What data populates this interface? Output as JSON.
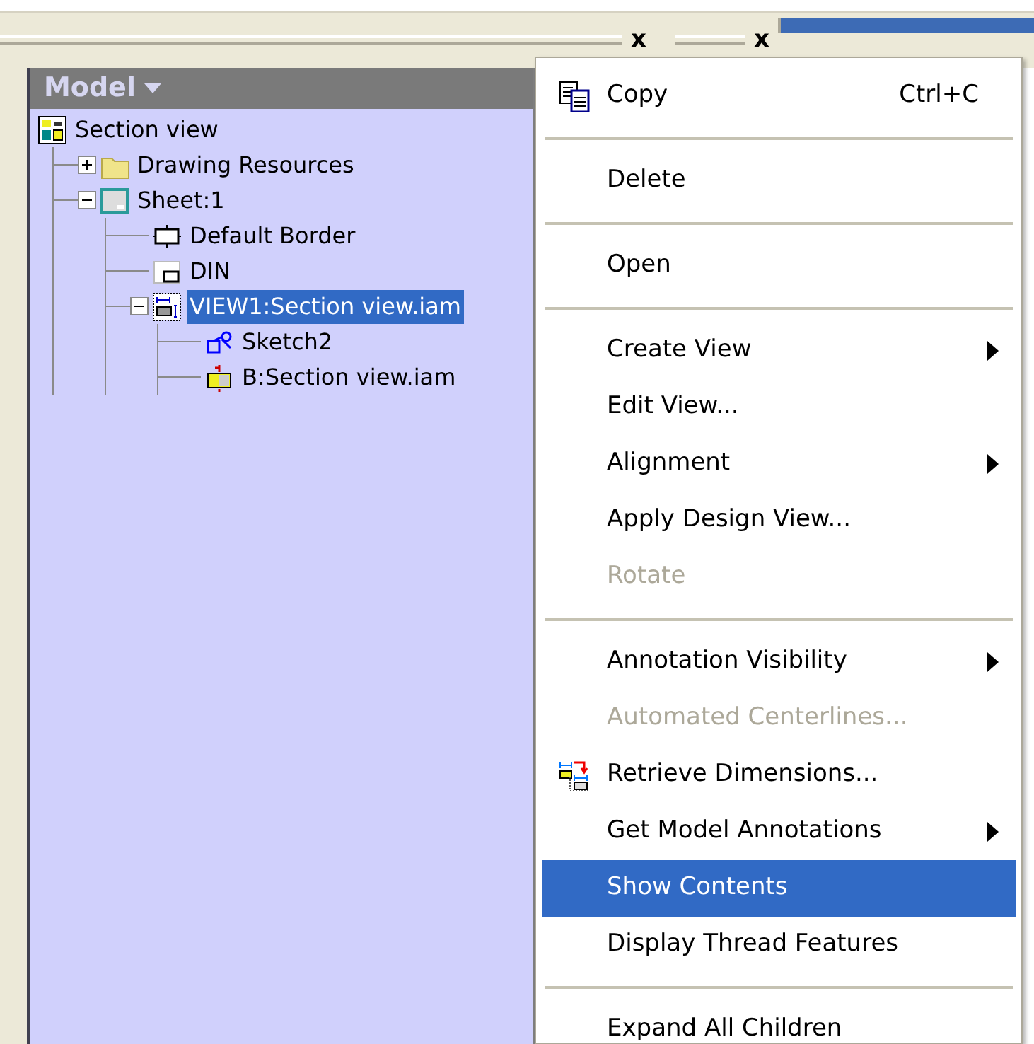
{
  "toolbar": {
    "close_buttons": [
      "x",
      "x"
    ]
  },
  "panel": {
    "title": "Model",
    "tree": [
      {
        "label": "Section view",
        "kind": "document",
        "selected": false,
        "children": [
          {
            "label": "Drawing Resources",
            "kind": "folder",
            "selected": false,
            "expanded": false
          },
          {
            "label": "Sheet:1",
            "kind": "sheet",
            "selected": false,
            "expanded": true,
            "children": [
              {
                "label": "Default Border",
                "kind": "border",
                "selected": false
              },
              {
                "label": "DIN",
                "kind": "title-block",
                "selected": false
              },
              {
                "label": "VIEW1:Section view.iam",
                "kind": "view",
                "selected": true,
                "expanded": true,
                "children": [
                  {
                    "label": "Sketch2",
                    "kind": "sketch",
                    "selected": false
                  },
                  {
                    "label": "B:Section view.iam",
                    "kind": "component",
                    "selected": false
                  }
                ]
              }
            ]
          }
        ]
      }
    ]
  },
  "context_menu": [
    {
      "kind": "copy",
      "label": "Copy",
      "shortcut": "Ctrl+C",
      "selected": false,
      "disabled": false,
      "submenu": false
    },
    {
      "kind": "separator"
    },
    {
      "kind": "plain",
      "label": "Delete",
      "selected": false,
      "disabled": false,
      "submenu": false
    },
    {
      "kind": "separator"
    },
    {
      "kind": "plain",
      "label": "Open",
      "selected": false,
      "disabled": false,
      "submenu": false
    },
    {
      "kind": "separator"
    },
    {
      "kind": "plain",
      "label": "Create View",
      "selected": false,
      "disabled": false,
      "submenu": true
    },
    {
      "kind": "plain",
      "label": "Edit View...",
      "selected": false,
      "disabled": false,
      "submenu": false
    },
    {
      "kind": "plain",
      "label": "Alignment",
      "selected": false,
      "disabled": false,
      "submenu": true
    },
    {
      "kind": "plain",
      "label": "Apply Design View...",
      "selected": false,
      "disabled": false,
      "submenu": false
    },
    {
      "kind": "plain",
      "label": "Rotate",
      "selected": false,
      "disabled": true,
      "submenu": false
    },
    {
      "kind": "separator"
    },
    {
      "kind": "plain",
      "label": "Annotation Visibility",
      "selected": false,
      "disabled": false,
      "submenu": true
    },
    {
      "kind": "plain",
      "label": "Automated Centerlines...",
      "selected": false,
      "disabled": true,
      "submenu": false
    },
    {
      "kind": "retrieve",
      "label": "Retrieve Dimensions...",
      "selected": false,
      "disabled": false,
      "submenu": false
    },
    {
      "kind": "plain",
      "label": "Get Model Annotations",
      "selected": false,
      "disabled": false,
      "submenu": true
    },
    {
      "kind": "plain",
      "label": "Show Contents",
      "selected": true,
      "disabled": false,
      "submenu": false
    },
    {
      "kind": "plain",
      "label": "Display Thread Features",
      "selected": false,
      "disabled": false,
      "submenu": false
    },
    {
      "kind": "separator"
    },
    {
      "kind": "plain",
      "label": "Expand All Children",
      "selected": false,
      "disabled": false,
      "submenu": false
    }
  ]
}
